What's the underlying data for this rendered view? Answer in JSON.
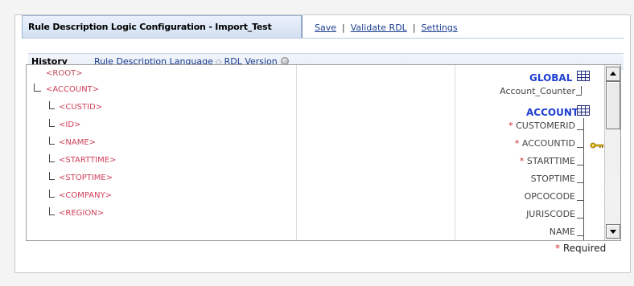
{
  "title": "Rule Description Logic Configuration - Import_Test",
  "actions": {
    "save": "Save",
    "validate": "Validate RDL",
    "settings": "Settings",
    "separator": "|"
  },
  "nav": {
    "history": "History",
    "rdl_language": "Rule Description Language",
    "rdl_version": "RDL Version"
  },
  "tree": {
    "root": "<ROOT>",
    "account": "<ACCOUNT>",
    "children": [
      "<CUSTID>",
      "<ID>",
      "<NAME>",
      "<STARTTIME>",
      "<STOPTIME>",
      "<COMPANY>",
      "<REGION>"
    ]
  },
  "schema": {
    "global_entity": "GLOBAL",
    "global_fields": [
      "Account_Counter"
    ],
    "account_entity": "ACCOUNT",
    "account_fields": [
      {
        "name": "CUSTOMERID",
        "required": true
      },
      {
        "name": "ACCOUNTID",
        "required": true,
        "key": true
      },
      {
        "name": "STARTTIME",
        "required": true
      },
      {
        "name": "STOPTIME",
        "required": false
      },
      {
        "name": "OPCOCODE",
        "required": false
      },
      {
        "name": "JURISCODE",
        "required": false
      },
      {
        "name": "NAME",
        "required": false
      }
    ],
    "required_marker": "*"
  },
  "footer": {
    "required_marker": "*",
    "required_label": "Required"
  },
  "colors": {
    "link": "#1a3d8f",
    "tag": "#d0405a",
    "entity": "#1f3fd0",
    "required": "#d02a2a"
  }
}
